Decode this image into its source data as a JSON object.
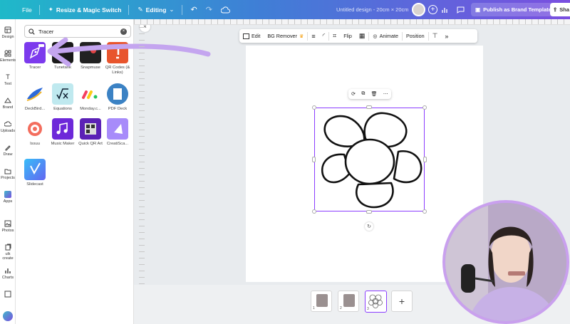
{
  "topbar": {
    "file_label": "File",
    "resize_label": "Resize & Magic Switch",
    "editing_label": "Editing",
    "doc_title": "Untitled design - 20cm × 20cm",
    "publish_label": "Publish as Brand Template",
    "share_label": "Sha"
  },
  "rail": {
    "items": [
      {
        "label": "Design",
        "icon": "layout-icon"
      },
      {
        "label": "Elements",
        "icon": "shapes-icon"
      },
      {
        "label": "Text",
        "icon": "text-icon"
      },
      {
        "label": "Brand",
        "icon": "brand-icon"
      },
      {
        "label": "Uploads",
        "icon": "cloud-upload-icon"
      },
      {
        "label": "Draw",
        "icon": "pen-icon"
      },
      {
        "label": "Projects",
        "icon": "folder-icon"
      },
      {
        "label": "Apps",
        "icon": "apps-icon"
      },
      {
        "label": "Photos",
        "icon": "photo-icon"
      },
      {
        "label": "ulk create",
        "icon": "bulk-create-icon"
      },
      {
        "label": "Charts",
        "icon": "chart-icon"
      }
    ]
  },
  "search": {
    "value": "Tracer"
  },
  "apps": [
    {
      "label": "Tracer",
      "color": "#7c3aed"
    },
    {
      "label": "Tunetank",
      "color": "#1a1a1a"
    },
    {
      "label": "Snapmuse",
      "color": "#222222"
    },
    {
      "label": "QR Codes (& Links)",
      "color": "#e8552d"
    },
    {
      "label": "DeckBird...",
      "color": "#ffffff"
    },
    {
      "label": "Equations",
      "color": "#bfe9ef"
    },
    {
      "label": "Monday.c...",
      "color": "#ffffff"
    },
    {
      "label": "PDF Deck",
      "color": "#3b82c4"
    },
    {
      "label": "Issuu",
      "color": "#ffffff"
    },
    {
      "label": "Music Maker",
      "color": "#6d28d9"
    },
    {
      "label": "Quick QR Art",
      "color": "#5b21b6"
    },
    {
      "label": "CreatiSca...",
      "color": "#a78bfa"
    },
    {
      "label": "Slidecast",
      "color": "#38bdf8"
    }
  ],
  "context_toolbar": {
    "edit_label": "Edit",
    "bg_remover_label": "BG Remover",
    "flip_label": "Flip",
    "animate_label": "Animate",
    "position_label": "Position"
  },
  "pages": [
    {
      "num": "1"
    },
    {
      "num": "2"
    },
    {
      "num": "3"
    }
  ]
}
